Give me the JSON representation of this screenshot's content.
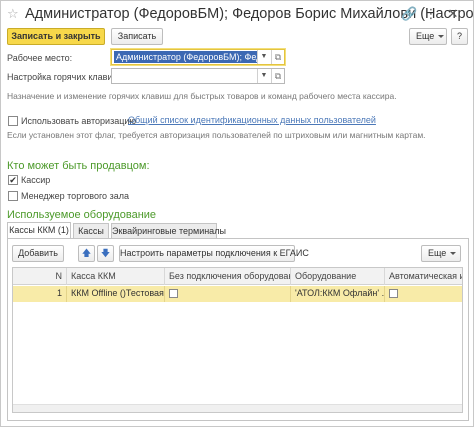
{
  "window": {
    "title": "Администратор (ФедоровБМ); Федоров Борис Михайлови (Настро...",
    "icons": [
      "link-icon",
      "more-vertical-icon",
      "close-icon"
    ],
    "nav_icons": [
      "back-icon",
      "forward-icon",
      "star-icon"
    ]
  },
  "toolbar": {
    "save_close_label": "Записать и закрыть",
    "save_label": "Записать",
    "more_label": "Еще",
    "help_label": "?"
  },
  "form": {
    "workplace_label": "Рабочее место:",
    "workplace_value": "Администратор (ФедоровБМ); Федоров",
    "hotkeys_label": "Настройка горячих клавиш:",
    "hotkeys_value": "",
    "hotkeys_hint": "Назначение и изменение горячих клавиш для быстрых товаров и команд рабочего места кассира.",
    "auth_label": "Использовать авторизацию",
    "auth_checked": false,
    "auth_link": "Общий список идентификационных данных пользователей",
    "auth_hint": "Если установлен этот флаг, требуется авторизация пользователей по штриховым или магнитным картам."
  },
  "seller": {
    "title": "Кто может быть продавцом:",
    "cashier_label": "Кассир",
    "cashier_checked": true,
    "manager_label": "Менеджер торгового зала",
    "manager_checked": false
  },
  "equipment": {
    "title": "Используемое оборудование",
    "tabs": [
      "Кассы ККМ (1)",
      "Кассы",
      "Эквайринговые терминалы"
    ],
    "active_tab": 0,
    "add_label": "Добавить",
    "egais_label": "Настроить параметры подключения к ЕГАИС",
    "more_label": "Еще",
    "columns": [
      "N",
      "Касса ККМ",
      "Без подключения оборудования",
      "Оборудование",
      "Автоматическая инк"
    ],
    "rows": [
      {
        "n": "1",
        "kkm": "ККМ Offline ()Тестовая",
        "no_hw": false,
        "hw": "'АТОЛ:ККМ Офлайн' ...",
        "auto": false
      }
    ]
  },
  "colors": {
    "accent_yellow": "#f7d84a",
    "section_green": "#4c9a2a",
    "link_blue": "#4b78b8",
    "selection_blue": "#3c68b3",
    "row_highlight": "#f8eba8"
  }
}
